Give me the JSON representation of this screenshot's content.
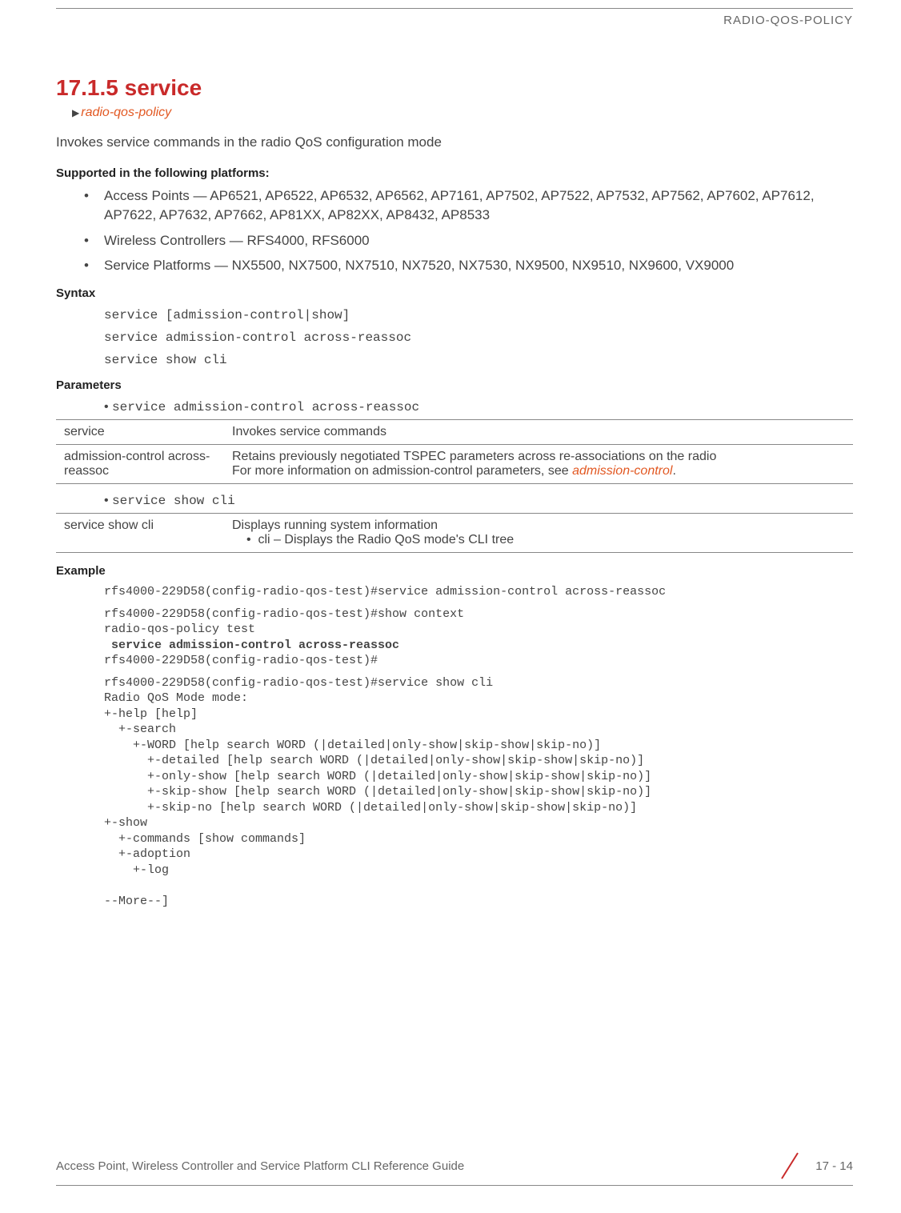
{
  "header": {
    "title": "RADIO-QOS-POLICY"
  },
  "section": {
    "number_title": "17.1.5 service",
    "breadcrumb": "radio-qos-policy",
    "description": "Invokes service commands in the radio QoS configuration mode"
  },
  "supported": {
    "heading": "Supported in the following platforms:",
    "items": [
      "Access Points — AP6521, AP6522, AP6532, AP6562, AP7161, AP7502, AP7522, AP7532, AP7562, AP7602, AP7612, AP7622, AP7632, AP7662, AP81XX, AP82XX, AP8432, AP8533",
      "Wireless Controllers — RFS4000, RFS6000",
      "Service Platforms — NX5500, NX7500, NX7510, NX7520, NX7530, NX9500, NX9510, NX9600, VX9000"
    ]
  },
  "syntax": {
    "heading": "Syntax",
    "lines": [
      "service [admission-control|show]",
      "service admission-control across-reassoc",
      "service show cli"
    ]
  },
  "parameters": {
    "heading": "Parameters",
    "groups": [
      {
        "bullet": "service admission-control across-reassoc",
        "rows": [
          {
            "label": "service",
            "desc": "Invokes service commands"
          },
          {
            "label": "admission-control across-reassoc",
            "desc_prefix": "Retains previously negotiated TSPEC parameters across re-associations on the radio",
            "desc_line2_prefix": "For more information on admission-control parameters, see ",
            "desc_link": "admission-control",
            "desc_suffix": "."
          }
        ]
      },
      {
        "bullet": "service show cli",
        "rows": [
          {
            "label": "service show cli",
            "desc": "Displays running system information",
            "sub": "cli – Displays the Radio QoS mode's CLI tree"
          }
        ]
      }
    ]
  },
  "example": {
    "heading": "Example",
    "block1_line1": "rfs4000-229D58(config-radio-qos-test)#service admission-control across-reassoc",
    "block2_line1": "rfs4000-229D58(config-radio-qos-test)#show context",
    "block2_line2": "radio-qos-policy test",
    "block2_line3_bold": " service admission-control across-reassoc",
    "block2_line4": "rfs4000-229D58(config-radio-qos-test)#",
    "block3": "rfs4000-229D58(config-radio-qos-test)#service show cli\nRadio QoS Mode mode:\n+-help [help]\n  +-search\n    +-WORD [help search WORD (|detailed|only-show|skip-show|skip-no)]\n      +-detailed [help search WORD (|detailed|only-show|skip-show|skip-no)]\n      +-only-show [help search WORD (|detailed|only-show|skip-show|skip-no)]\n      +-skip-show [help search WORD (|detailed|only-show|skip-show|skip-no)]\n      +-skip-no [help search WORD (|detailed|only-show|skip-show|skip-no)]\n+-show\n  +-commands [show commands]\n  +-adoption\n    +-log\n\n--More--]"
  },
  "footer": {
    "guide": "Access Point, Wireless Controller and Service Platform CLI Reference Guide",
    "page": "17 - 14"
  }
}
